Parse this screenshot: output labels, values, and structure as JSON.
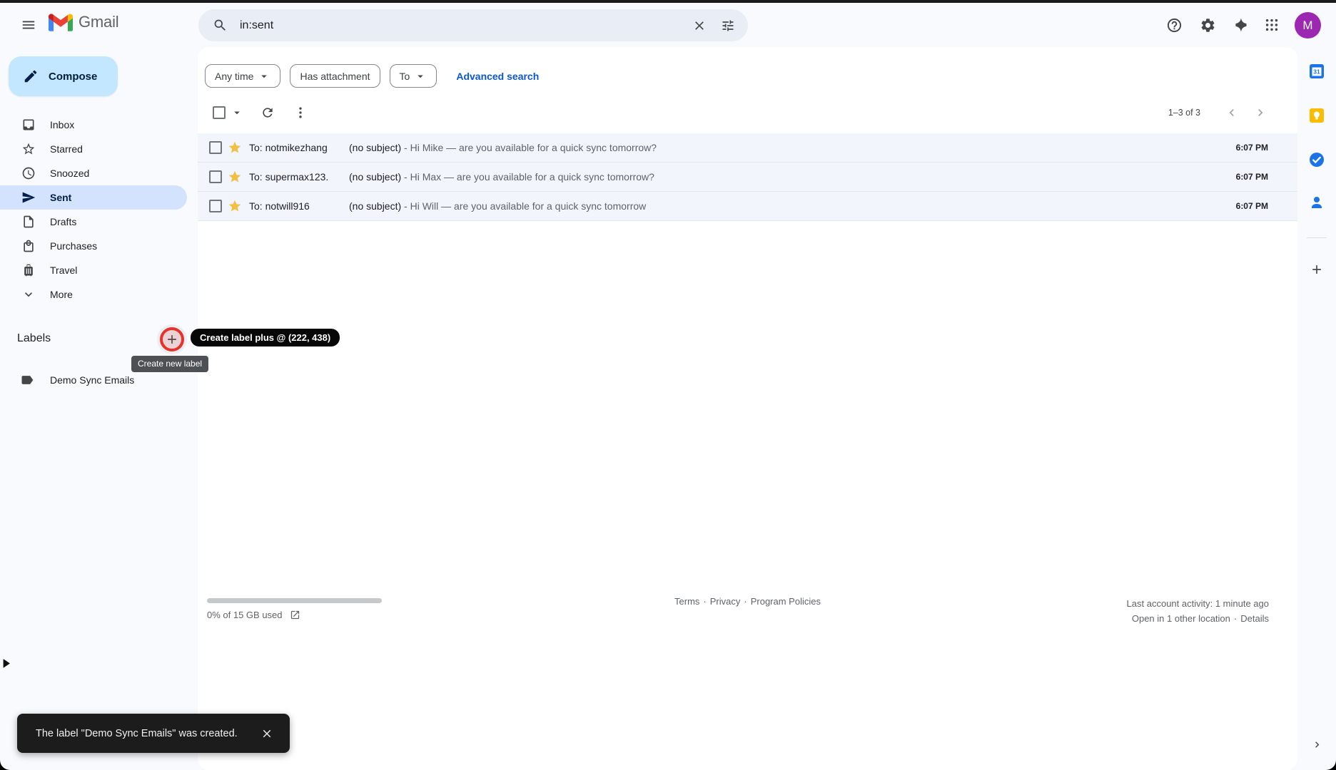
{
  "header": {
    "product_name": "Gmail",
    "search_value": "in:sent",
    "avatar_initial": "M",
    "icons": [
      "hamburger-menu",
      "search",
      "clear",
      "filter-tune",
      "help",
      "settings-gear",
      "gemini-sparkle",
      "google-apps",
      "account-avatar"
    ]
  },
  "sidebar": {
    "compose_label": "Compose",
    "items": [
      {
        "label": "Inbox",
        "icon": "inbox",
        "selected": false
      },
      {
        "label": "Starred",
        "icon": "star-outline",
        "selected": false
      },
      {
        "label": "Snoozed",
        "icon": "clock",
        "selected": false
      },
      {
        "label": "Sent",
        "icon": "send",
        "selected": true
      },
      {
        "label": "Drafts",
        "icon": "draft-file",
        "selected": false
      },
      {
        "label": "Purchases",
        "icon": "shopping-bag",
        "selected": false
      },
      {
        "label": "Travel",
        "icon": "luggage",
        "selected": false
      },
      {
        "label": "More",
        "icon": "chevron-down",
        "selected": false
      }
    ],
    "labels_heading": "Labels",
    "labels": [
      {
        "name": "Demo Sync Emails",
        "icon": "label-tag"
      }
    ]
  },
  "annotation": {
    "tooltip_text": "Create label plus @ (222, 438)",
    "circle_color": "#e8312a"
  },
  "tooltips": {
    "create_label": "Create new label"
  },
  "filters": {
    "chips": [
      {
        "label": "Any time",
        "dropdown": true
      },
      {
        "label": "Has attachment",
        "dropdown": false
      },
      {
        "label": "To",
        "dropdown": true
      }
    ],
    "advanced_search": "Advanced search"
  },
  "toolbar": {
    "pagination": "1–3 of 3"
  },
  "emails": [
    {
      "to": "To: notmikezhang",
      "subject": "(no subject)",
      "snippet": "- Hi Mike — are you available for a quick sync tomorrow?",
      "time": "6:07 PM",
      "starred": true
    },
    {
      "to": "To: supermax123.",
      "subject": "(no subject)",
      "snippet": "- Hi Max — are you available for a quick sync tomorrow?",
      "time": "6:07 PM",
      "starred": true
    },
    {
      "to": "To: notwill916",
      "subject": "(no subject)",
      "snippet": "- Hi Will — are you available for a quick sync tomorrow",
      "time": "6:07 PM",
      "starred": true
    }
  ],
  "footer": {
    "storage": "0% of 15 GB used",
    "legal": [
      "Terms",
      "Privacy",
      "Program Policies"
    ],
    "separator": "·",
    "activity_line1": "Last account activity: 1 minute ago",
    "activity_line2_text": "Open in 1 other location",
    "activity_details": "Details"
  },
  "side_panel": {
    "apps": [
      "calendar",
      "keep",
      "tasks",
      "contacts"
    ],
    "plus": "get-add-ons",
    "expand": "chevron-right"
  },
  "snackbar": {
    "message": "The label \"Demo Sync Emails\" was created."
  },
  "colors": {
    "accent_blue": "#0b57d0",
    "compose_bg": "#c2e7ff",
    "selected_item_bg": "#d3e3fd",
    "avatar_purple": "#9c27b0",
    "annotation_red": "#e8312a",
    "star_gold": "#f2bf42",
    "snackbar_bg": "#1c1c1c",
    "read_row_bg": "#f2f6fc"
  }
}
